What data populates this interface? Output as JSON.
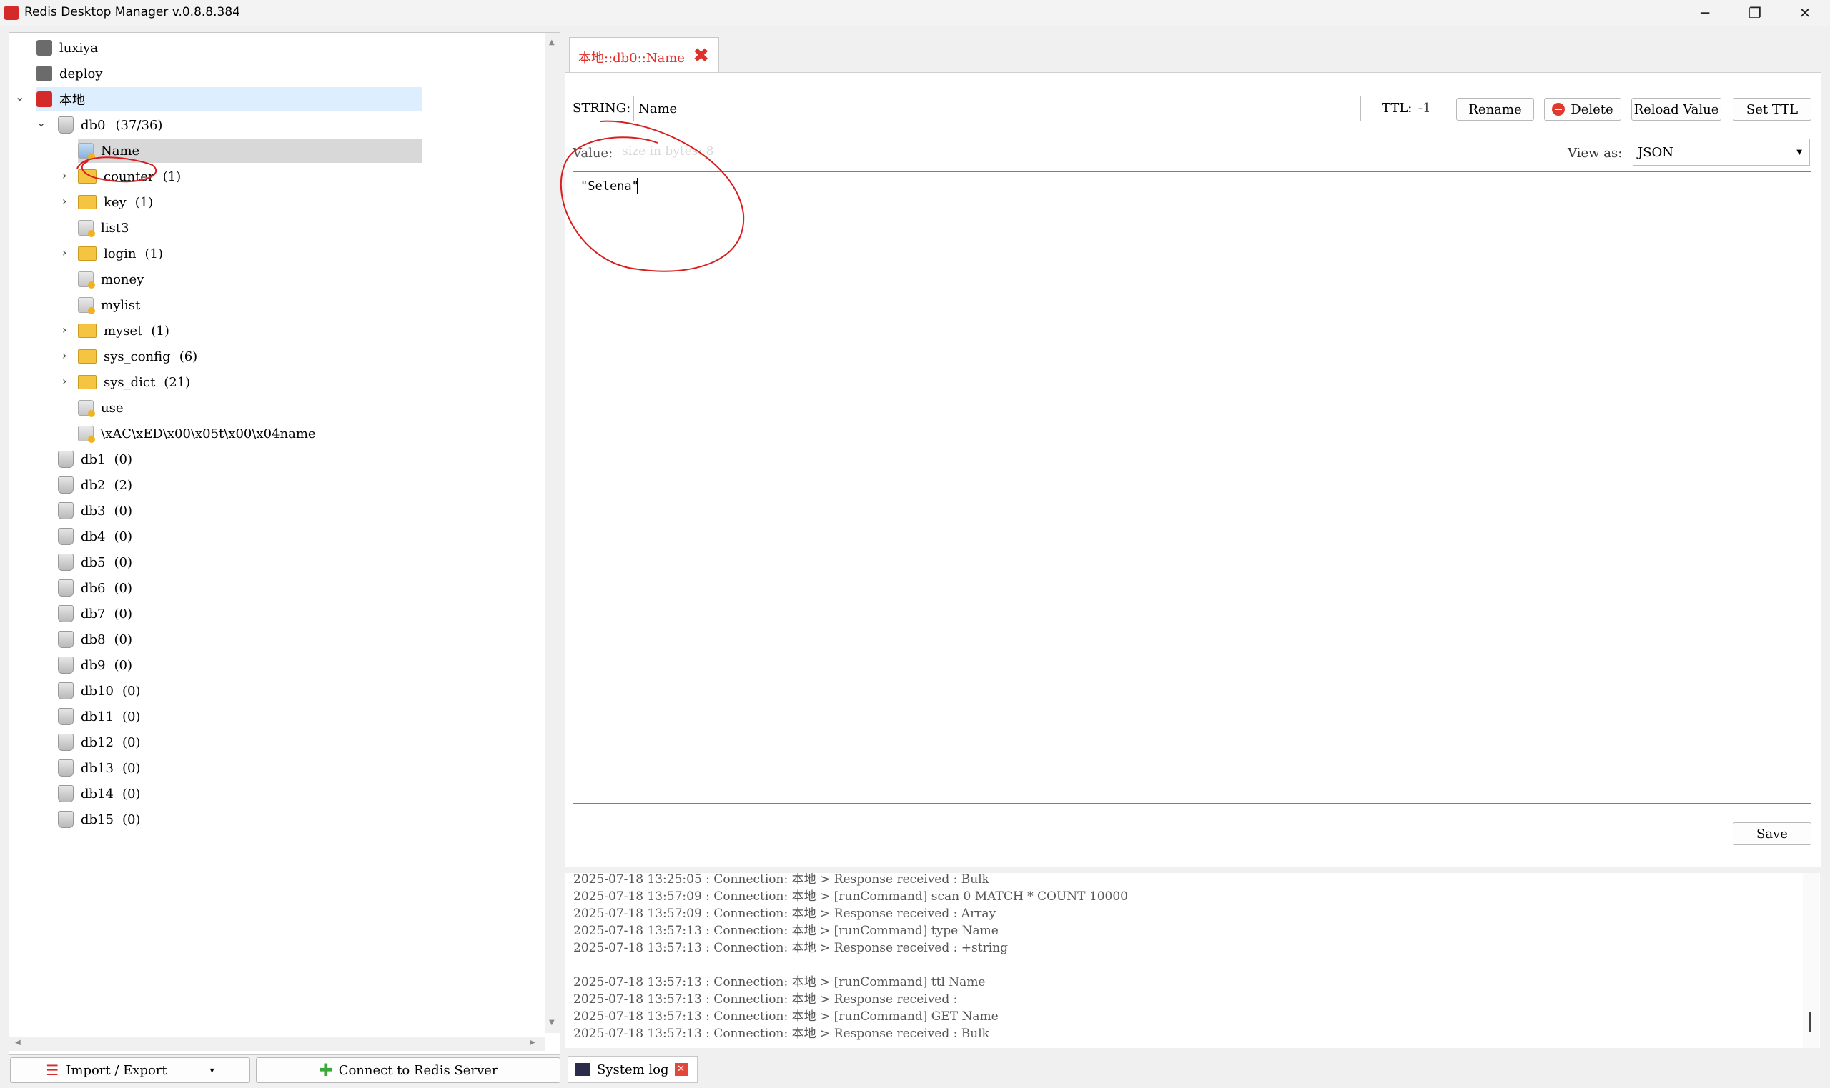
{
  "window": {
    "title": "Redis Desktop Manager v.0.8.8.384"
  },
  "tree": {
    "connections": [
      {
        "label": "luxiya"
      },
      {
        "label": "deploy"
      },
      {
        "label": "本地"
      }
    ],
    "db0": {
      "label": "db0",
      "count": "(37/36)"
    },
    "keys": [
      {
        "label": "Name",
        "type": "key",
        "selected": true
      },
      {
        "label": "counter",
        "count": "(1)",
        "type": "folder"
      },
      {
        "label": "key",
        "count": "(1)",
        "type": "folder"
      },
      {
        "label": "list3",
        "type": "key"
      },
      {
        "label": "login",
        "count": "(1)",
        "type": "folder"
      },
      {
        "label": "money",
        "type": "key"
      },
      {
        "label": "mylist",
        "type": "key"
      },
      {
        "label": "myset",
        "count": "(1)",
        "type": "folder"
      },
      {
        "label": "sys_config",
        "count": "(6)",
        "type": "folder"
      },
      {
        "label": "sys_dict",
        "count": "(21)",
        "type": "folder"
      },
      {
        "label": "use",
        "type": "key"
      },
      {
        "label": "\\xAC\\xED\\x00\\x05t\\x00\\x04name",
        "type": "key"
      }
    ],
    "databases": [
      {
        "label": "db1",
        "count": "(0)"
      },
      {
        "label": "db2",
        "count": "(2)"
      },
      {
        "label": "db3",
        "count": "(0)"
      },
      {
        "label": "db4",
        "count": "(0)"
      },
      {
        "label": "db5",
        "count": "(0)"
      },
      {
        "label": "db6",
        "count": "(0)"
      },
      {
        "label": "db7",
        "count": "(0)"
      },
      {
        "label": "db8",
        "count": "(0)"
      },
      {
        "label": "db9",
        "count": "(0)"
      },
      {
        "label": "db10",
        "count": "(0)"
      },
      {
        "label": "db11",
        "count": "(0)"
      },
      {
        "label": "db12",
        "count": "(0)"
      },
      {
        "label": "db13",
        "count": "(0)"
      },
      {
        "label": "db14",
        "count": "(0)"
      },
      {
        "label": "db15",
        "count": "(0)"
      }
    ]
  },
  "bottom_left": {
    "import_export": "Import / Export",
    "connect": "Connect to Redis Server"
  },
  "tab": {
    "title": "本地::db0::Name"
  },
  "key_editor": {
    "type_label": "STRING:",
    "key_name": "Name",
    "ttl_label": "TTL:",
    "ttl_value": "-1",
    "rename": "Rename",
    "delete": "Delete",
    "reload": "Reload Value",
    "set_ttl": "Set TTL",
    "value_label": "Value:",
    "size_text": "size in bytes: 8",
    "view_as_label": "View as:",
    "view_as_value": "JSON",
    "value_text": "\"Selena\"",
    "save": "Save"
  },
  "log": {
    "lines": [
      "2025-07-18 13:25:05 : Connection: 本地 > Response received : Bulk",
      "2025-07-18 13:57:09 : Connection: 本地 > [runCommand] scan 0 MATCH * COUNT 10000",
      "2025-07-18 13:57:09 : Connection: 本地 > Response received : Array",
      "2025-07-18 13:57:13 : Connection: 本地 > [runCommand] type Name",
      "2025-07-18 13:57:13 : Connection: 本地 > Response received : +string",
      "",
      "2025-07-18 13:57:13 : Connection: 本地 > [runCommand] ttl Name",
      "2025-07-18 13:57:13 : Connection: 本地 > Response received :",
      "2025-07-18 13:57:13 : Connection: 本地 > [runCommand] GET Name",
      "2025-07-18 13:57:13 : Connection: 本地 > Response received : Bulk"
    ],
    "tab_label": "System log"
  },
  "colors": {
    "accent_red": "#d42a2a",
    "annotation_red": "#d81e1e",
    "tab_text": "#e0302a"
  }
}
